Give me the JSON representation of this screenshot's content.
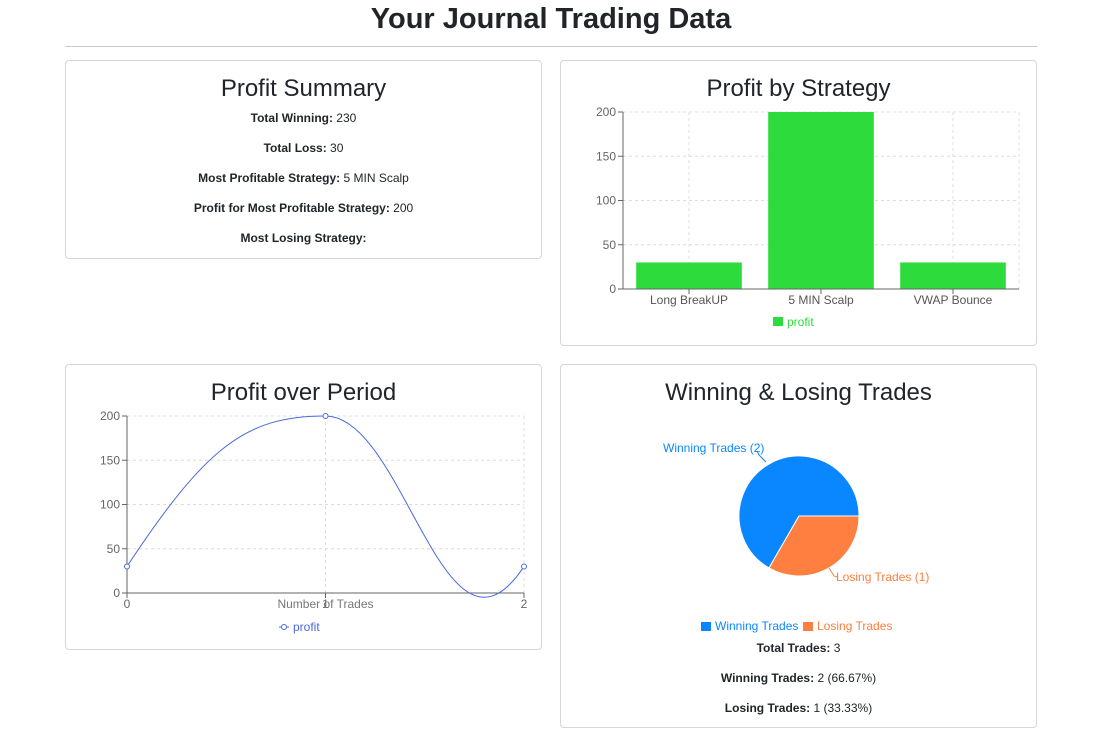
{
  "page": {
    "title": "Your Journal Trading Data"
  },
  "profit_summary": {
    "title": "Profit Summary",
    "rows": [
      {
        "label": "Total Winning:",
        "value": "230"
      },
      {
        "label": "Total Loss:",
        "value": "30"
      },
      {
        "label": "Most Profitable Strategy:",
        "value": "5 MIN Scalp"
      },
      {
        "label": "Profit for Most Profitable Strategy:",
        "value": "200"
      },
      {
        "label": "Most Losing Strategy:",
        "value": ""
      }
    ]
  },
  "colors": {
    "bar": "#2ddb3d",
    "line": "#4a6ad8",
    "winning": "#0a87ff",
    "losing": "#ff7f41"
  },
  "chart_data": [
    {
      "id": "strategy",
      "type": "bar",
      "title": "Profit by Strategy",
      "categories": [
        "Long BreakUP",
        "5 MIN Scalp",
        "VWAP Bounce"
      ],
      "series": [
        {
          "name": "profit",
          "values": [
            30,
            200,
            30
          ]
        }
      ],
      "ylim": [
        0,
        200
      ],
      "yticks": [
        0,
        50,
        100,
        150,
        200
      ],
      "grid": true,
      "legend": "bottom"
    },
    {
      "id": "period",
      "type": "line",
      "title": "Profit over Period",
      "xlabel": "Number of Trades",
      "x": [
        0,
        1,
        2
      ],
      "series": [
        {
          "name": "profit",
          "values": [
            30,
            200,
            30
          ]
        }
      ],
      "ylim": [
        0,
        200
      ],
      "yticks": [
        0,
        50,
        100,
        150,
        200
      ],
      "xticks": [
        0,
        1,
        2
      ],
      "grid": true,
      "legend": "bottom"
    },
    {
      "id": "winloss",
      "type": "pie",
      "title": "Winning & Losing Trades",
      "slices": [
        {
          "name": "Winning Trades",
          "value": 2,
          "label": "Winning Trades (2)"
        },
        {
          "name": "Losing Trades",
          "value": 1,
          "label": "Losing Trades (1)"
        }
      ],
      "legend": "bottom"
    }
  ],
  "trade_stats": {
    "total_label": "Total Trades:",
    "total_value": "3",
    "winning_label": "Winning Trades:",
    "winning_value": "2 (66.67%)",
    "losing_label": "Losing Trades:",
    "losing_value": "1 (33.33%)"
  }
}
